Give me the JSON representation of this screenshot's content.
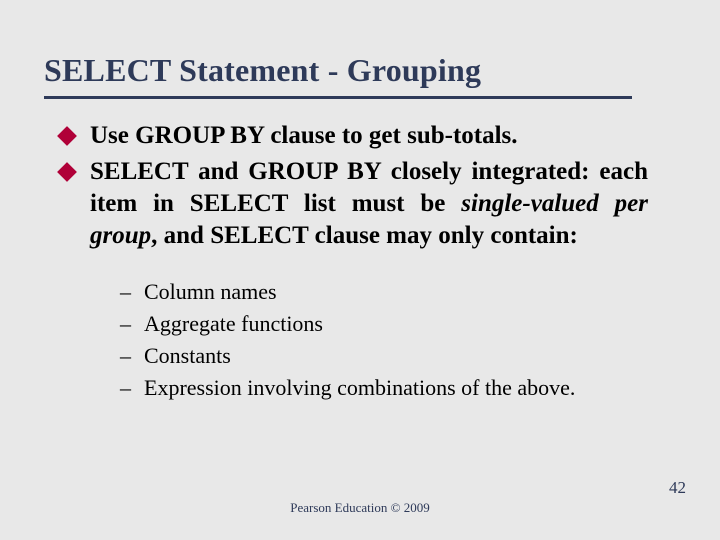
{
  "title": "SELECT Statement - Grouping",
  "bullets": [
    {
      "text": "Use GROUP BY clause to get sub-totals.",
      "justify": false
    },
    {
      "segments": [
        "SELECT and GROUP BY closely integrated: each item in SELECT list must be ",
        {
          "em": "single-valued per group"
        },
        ", and SELECT clause may only contain:"
      ],
      "justify": true
    }
  ],
  "subitems": [
    "Column names",
    "Aggregate functions",
    "Constants",
    "Expression involving combinations of the above."
  ],
  "footer": "Pearson Education © 2009",
  "page": "42"
}
